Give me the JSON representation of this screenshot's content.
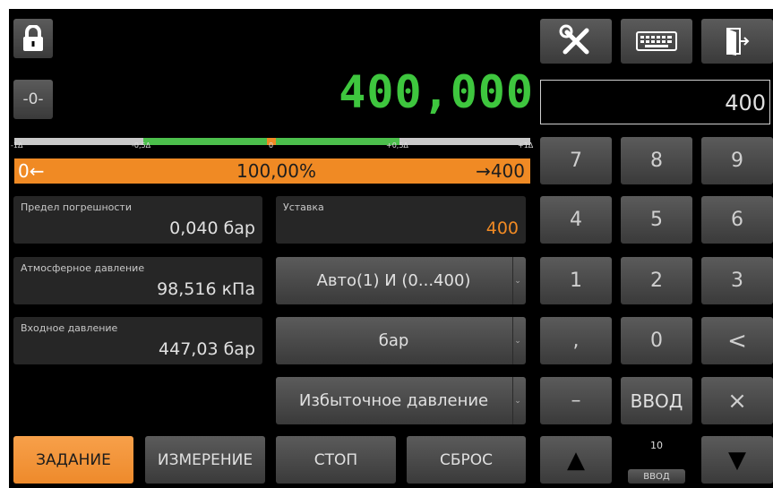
{
  "display": {
    "value": "400,000",
    "input_value": "400"
  },
  "toolbar": {
    "zero_label": "-0-"
  },
  "scale": {
    "ticks": [
      "-1Δ",
      "-0,5Δ",
      "0",
      "+0,5Δ",
      "+1Δ"
    ],
    "progress": {
      "left": "0←",
      "center": "100,00%",
      "right": "→400",
      "fraction": 1.0
    }
  },
  "panels": {
    "error_limit": {
      "label": "Предел погрешности",
      "value": "0,040 бар"
    },
    "setpoint": {
      "label": "Уставка",
      "value": "400"
    },
    "atm_pressure": {
      "label": "Атмосферное давление",
      "value": "98,516 кПа"
    },
    "input_pressure": {
      "label": "Входное давление",
      "value": "447,03 бар"
    }
  },
  "selects": {
    "mode": "Авто(1) И (0...400)",
    "unit": "бар",
    "pressure_type": "Избыточное давление"
  },
  "keypad": {
    "row1": [
      "7",
      "8",
      "9"
    ],
    "row2": [
      "4",
      "5",
      "6"
    ],
    "row3": [
      "1",
      "2",
      "3"
    ],
    "comma": ",",
    "zero": "0",
    "backspace": "<",
    "minus": "–",
    "enter": "ВВОД",
    "clear": "×",
    "up": "▲",
    "down": "▼",
    "step_value": "10",
    "step_label": "ВВОД"
  },
  "bottom": {
    "task": "ЗАДАНИЕ",
    "measure": "ИЗМЕРЕНИЕ",
    "stop": "СТОП",
    "reset": "СБРОС"
  },
  "colors": {
    "accent": "#f08a24",
    "display_green": "#3ec63e",
    "tolerance_green": "#4cbf4c"
  }
}
